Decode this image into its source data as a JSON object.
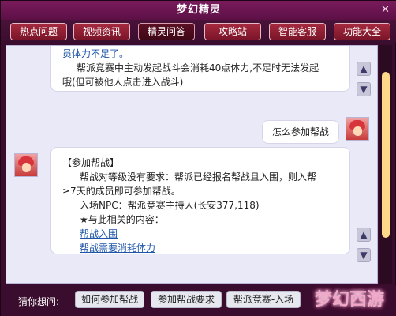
{
  "window": {
    "title": "梦幻精灵"
  },
  "tabs": [
    {
      "label": "热点问题"
    },
    {
      "label": "视频资讯"
    },
    {
      "label": "精灵问答"
    },
    {
      "label": "攻略站"
    },
    {
      "label": "智能客服"
    },
    {
      "label": "功能大全"
    }
  ],
  "chat": {
    "first_answer": {
      "lines": [
        "员体力不足了。",
        "帮派竞赛中主动发起战斗会消耗40点体力,不足时无法发起",
        "哦(但可被他人点击进入战斗)"
      ]
    },
    "user_question": "怎么参加帮战",
    "second_answer": {
      "title": "【参加帮战】",
      "lines": [
        "帮战对等级没有要求：帮派已经报名帮战且入围，则入帮",
        "≥7天的成员即可参加帮战。",
        "入场NPC：帮派竞赛主持人(长安377,118)",
        "★与此相关的内容："
      ],
      "links": [
        "帮战入围",
        "帮战需要消耗体力"
      ]
    }
  },
  "bottom": {
    "guess_label": "猜你想问:",
    "suggestions": [
      "如何参加帮战",
      "参加帮战要求",
      "帮派竞赛-入场"
    ],
    "logo_text": "梦幻西游"
  },
  "colors": {
    "accent": "#7a1b5c",
    "tab": "#a52a3f",
    "link": "#1d55a8",
    "scroll_thumb": "#ffd88a"
  },
  "icons": {
    "thumb_up": "thumbs-up-icon",
    "thumb_down": "thumbs-down-icon",
    "close": "close-icon"
  }
}
